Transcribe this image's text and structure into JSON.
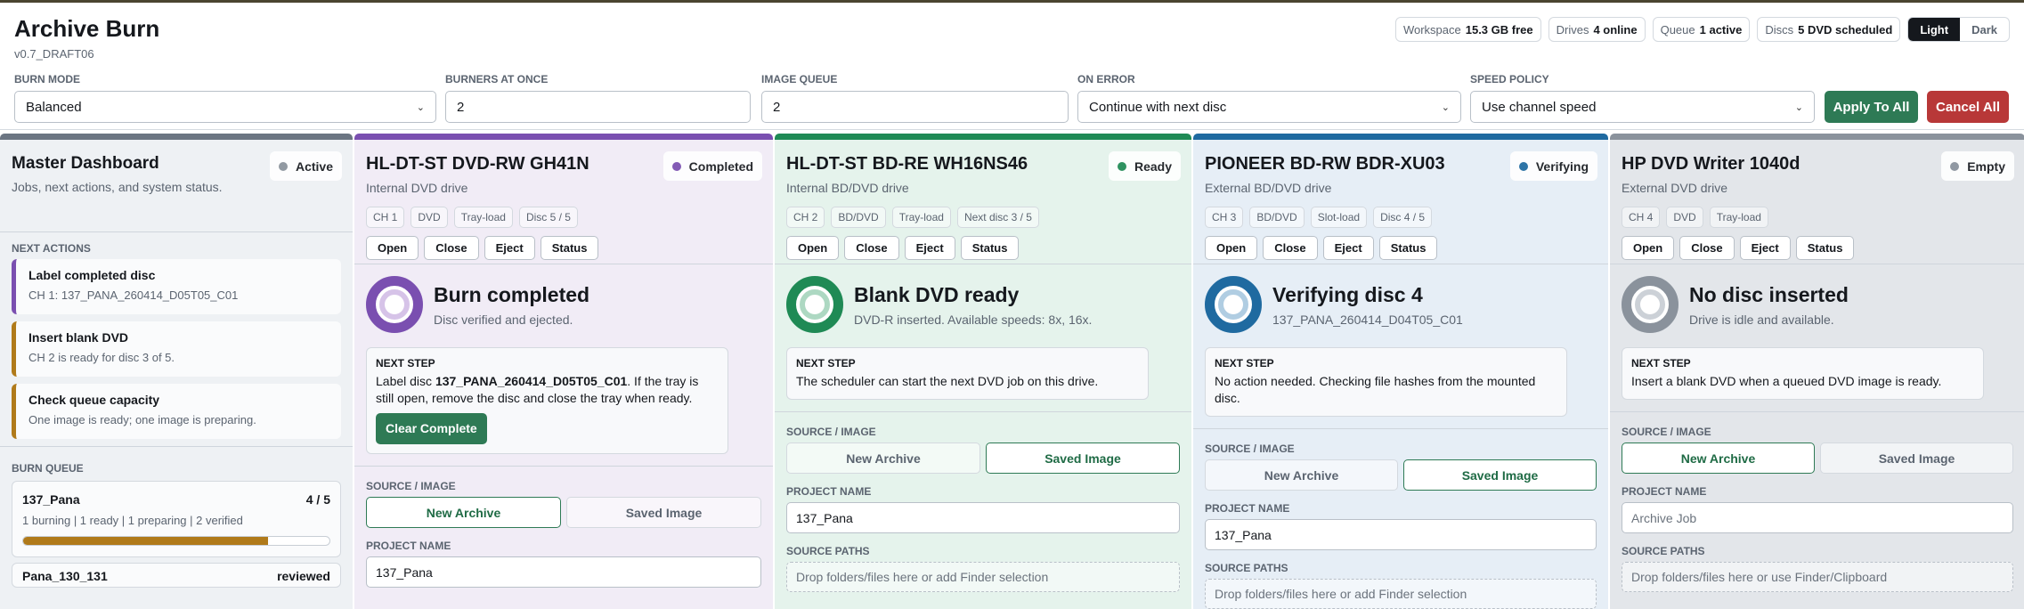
{
  "app": {
    "title": "Archive Burn",
    "version": "v0.7_DRAFT06"
  },
  "stats": [
    {
      "label": "Workspace",
      "value": "15.3 GB free"
    },
    {
      "label": "Drives",
      "value": "4 online"
    },
    {
      "label": "Queue",
      "value": "1 active"
    },
    {
      "label": "Discs",
      "value": "5 DVD scheduled"
    }
  ],
  "theme": {
    "light": "Light",
    "dark": "Dark",
    "selected": "Light"
  },
  "controls": {
    "burn_mode": {
      "label": "BURN MODE",
      "value": "Balanced"
    },
    "burners": {
      "label": "BURNERS AT ONCE",
      "value": "2"
    },
    "image_queue": {
      "label": "IMAGE QUEUE",
      "value": "2"
    },
    "on_error": {
      "label": "ON ERROR",
      "value": "Continue with next disc"
    },
    "speed_policy": {
      "label": "SPEED POLICY",
      "value": "Use channel speed"
    },
    "apply": "Apply To All",
    "cancel": "Cancel All"
  },
  "master": {
    "title": "Master Dashboard",
    "subtitle": "Jobs, next actions, and system status.",
    "status": "Active",
    "next_actions_label": "NEXT ACTIONS",
    "actions": [
      {
        "title": "Label completed disc",
        "detail": "CH 1: 137_PANA_260414_D05T05_C01",
        "color": "#7a4fb0"
      },
      {
        "title": "Insert blank DVD",
        "detail": "CH 2 is ready for disc 3 of 5.",
        "color": "#b07a1a"
      },
      {
        "title": "Check queue capacity",
        "detail": "One image is ready; one image is preparing.",
        "color": "#b07a1a"
      }
    ],
    "burn_queue_label": "BURN QUEUE",
    "queue": [
      {
        "name": "137_Pana",
        "count": "4 / 5",
        "detail": "1 burning | 1 ready | 1 preparing | 2 verified",
        "progress": 0.8
      },
      {
        "name": "Pana_130_131",
        "count": "reviewed"
      }
    ]
  },
  "common": {
    "open": "Open",
    "close": "Close",
    "eject": "Eject",
    "status": "Status",
    "next_step": "NEXT STEP",
    "source_image": "SOURCE / IMAGE",
    "new_archive": "New Archive",
    "saved_image": "Saved Image",
    "project_name": "PROJECT NAME",
    "source_paths": "SOURCE PATHS"
  },
  "drives": [
    {
      "name": "HL-DT-ST DVD-RW GH41N",
      "type": "Internal DVD drive",
      "status": "Completed",
      "color": "#7a4fb0",
      "chips": [
        "CH 1",
        "DVD",
        "Tray-load",
        "Disc 5 / 5"
      ],
      "state_title": "Burn completed",
      "state_sub": "Disc verified and ejected.",
      "next_pre": "Label disc ",
      "next_bold": "137_PANA_260414_D05T05_C01",
      "next_post": ". If the tray is still open, remove the disc and close the tray when ready.",
      "action": "Clear Complete",
      "source": "New Archive",
      "project": "137_Pana"
    },
    {
      "name": "HL-DT-ST BD-RE WH16NS46",
      "type": "Internal BD/DVD drive",
      "status": "Ready",
      "color": "#1f8a55",
      "chips": [
        "CH 2",
        "BD/DVD",
        "Tray-load",
        "Next disc 3 / 5"
      ],
      "state_title": "Blank DVD ready",
      "state_sub": "DVD-R inserted. Available speeds: 8x, 16x.",
      "next_text": "The scheduler can start the next DVD job on this drive.",
      "source": "Saved Image",
      "project": "137_Pana",
      "paths_placeholder": "Drop folders/files here or add Finder selection"
    },
    {
      "name": "PIONEER BD-RW BDR-XU03",
      "type": "External BD/DVD drive",
      "status": "Verifying",
      "color": "#1f6aa0",
      "chips": [
        "CH 3",
        "BD/DVD",
        "Slot-load",
        "Disc 4 / 5"
      ],
      "state_title": "Verifying disc 4",
      "state_sub": "137_PANA_260414_D04T05_C01",
      "next_text": "No action needed. Checking file hashes from the mounted disc.",
      "source": "Saved Image",
      "project": "137_Pana",
      "paths_placeholder": "Drop folders/files here or add Finder selection"
    },
    {
      "name": "HP DVD Writer 1040d",
      "type": "External DVD drive",
      "status": "Empty",
      "color": "#8a929c",
      "chips": [
        "CH 4",
        "DVD",
        "Tray-load"
      ],
      "state_title": "No disc inserted",
      "state_sub": "Drive is idle and available.",
      "next_text": "Insert a blank DVD when a queued DVD image is ready.",
      "source": "New Archive",
      "project_placeholder": "Archive Job",
      "paths_placeholder": "Drop folders/files here or use Finder/Clipboard"
    }
  ]
}
